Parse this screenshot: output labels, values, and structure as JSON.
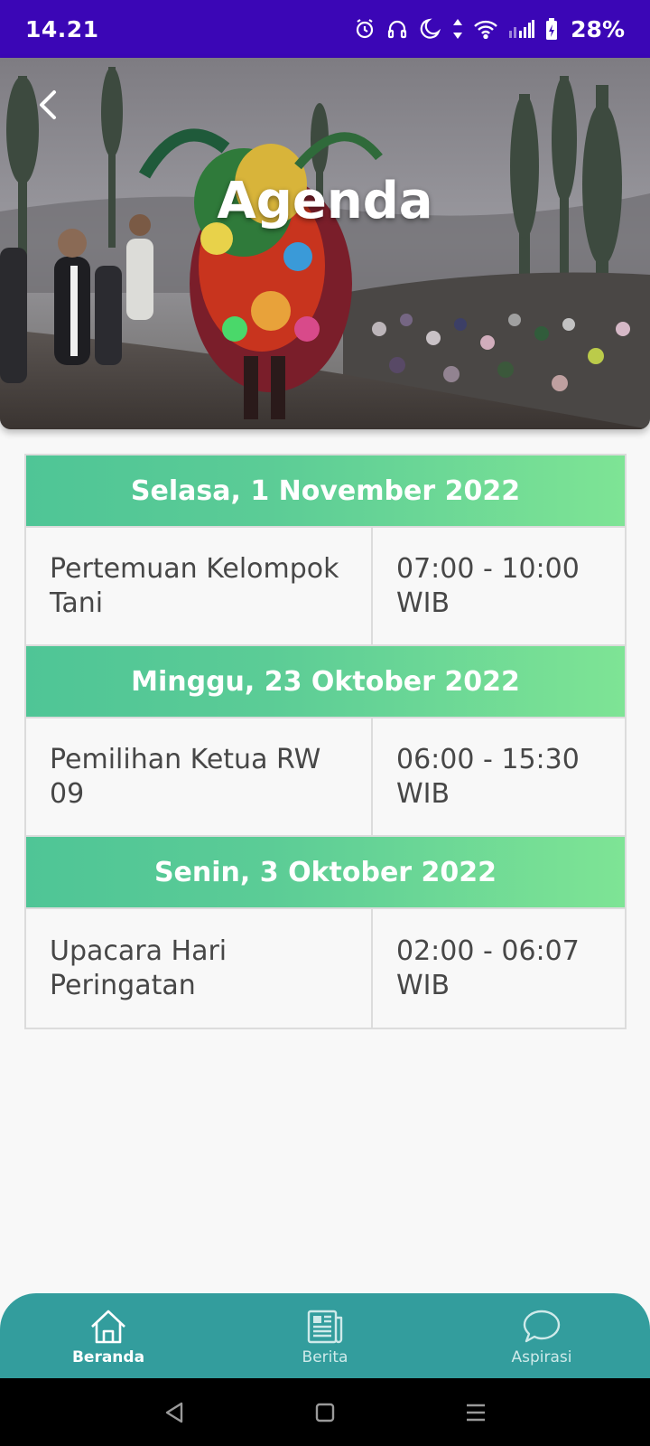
{
  "status_bar": {
    "time": "14.21",
    "battery": "28%",
    "icons": [
      "alarm-icon",
      "headphones-icon",
      "moon-icon",
      "data-arrows-icon",
      "wifi-icon",
      "signal-icon",
      "battery-icon"
    ]
  },
  "header": {
    "title": "Agenda",
    "back_icon": "chevron-left-icon"
  },
  "agenda": {
    "days": [
      {
        "date": "Selasa, 1 November 2022",
        "event": "Pertemuan Kelompok Tani",
        "time": "07:00 - 10:00 WIB"
      },
      {
        "date": "Minggu, 23 Oktober 2022",
        "event": "Pemilihan Ketua RW 09",
        "time": "06:00 - 15:30 WIB"
      },
      {
        "date": "Senin, 3 Oktober 2022",
        "event": "Upacara Hari Peringatan",
        "time": "02:00 - 06:07 WIB"
      }
    ],
    "colors": {
      "header_gradient_start": "#4fc596",
      "header_gradient_end": "#7ee495",
      "text": "#474747",
      "border": "#dcdcdc"
    }
  },
  "bottom_nav": {
    "items": [
      {
        "label": "Beranda",
        "icon": "home-icon",
        "active": true
      },
      {
        "label": "Berita",
        "icon": "newspaper-icon",
        "active": false
      },
      {
        "label": "Aspirasi",
        "icon": "chat-bubble-icon",
        "active": false
      }
    ],
    "color": "#339d9d"
  },
  "system_nav": {
    "icons": [
      "back-triangle-icon",
      "home-square-icon",
      "recents-menu-icon"
    ]
  },
  "colors": {
    "status_bar": "#3b06b6",
    "background": "#f8f8f8"
  }
}
